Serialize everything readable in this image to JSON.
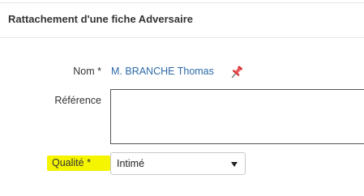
{
  "panel": {
    "title": "Rattachement d'une fiche Adversaire"
  },
  "form": {
    "nom": {
      "label": "Nom *",
      "value": "M. BRANCHE Thomas",
      "icon": "pin-icon"
    },
    "reference": {
      "label": "Référence",
      "value": ""
    },
    "qualite": {
      "label": "Qualité *",
      "selected": "Intimé",
      "highlight_color": "#f5f500"
    }
  },
  "colors": {
    "link": "#2c6aa8",
    "pin": "#d9383a"
  }
}
